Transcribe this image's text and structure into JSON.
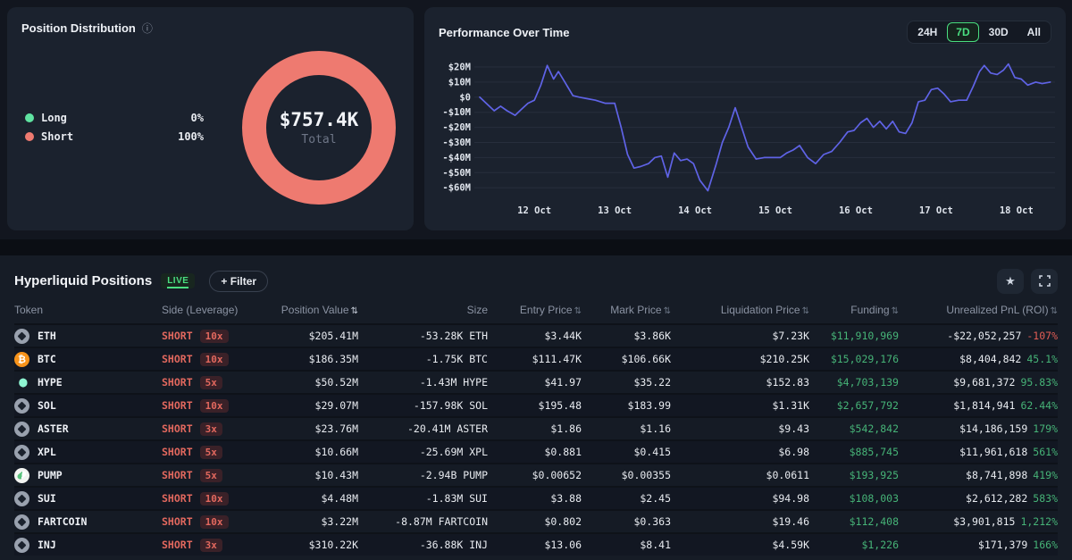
{
  "position_distribution": {
    "title": "Position Distribution",
    "info_icon": "ⓘ",
    "legend": [
      {
        "label": "Long",
        "pct": "0%",
        "color": "#5fe3a1"
      },
      {
        "label": "Short",
        "pct": "100%",
        "color": "#ee7a70"
      }
    ],
    "total_value": "$757.4K",
    "total_label": "Total",
    "donut_color": "#ee7a70"
  },
  "performance": {
    "title": "Performance Over Time",
    "ranges": [
      {
        "label": "24H",
        "active": false
      },
      {
        "label": "7D",
        "active": true
      },
      {
        "label": "30D",
        "active": false
      },
      {
        "label": "All",
        "active": false
      }
    ]
  },
  "chart_data": [
    {
      "type": "pie",
      "title": "Position Distribution",
      "labels": [
        "Long",
        "Short"
      ],
      "values": [
        0,
        100
      ],
      "colors": [
        "#5fe3a1",
        "#ee7a70"
      ],
      "center_total": "$757.4K"
    },
    {
      "type": "line",
      "title": "Performance Over Time",
      "unit": "$M",
      "line_color": "#5f63e6",
      "grid": true,
      "xlim": [
        11.32,
        18.48
      ],
      "ylim": [
        -66,
        25
      ],
      "y_ticks": [
        {
          "value": 20,
          "label": "$20M"
        },
        {
          "value": 10,
          "label": "$10M"
        },
        {
          "value": 0,
          "label": "$0"
        },
        {
          "value": -10,
          "label": "-$10M"
        },
        {
          "value": -20,
          "label": "-$20M"
        },
        {
          "value": -30,
          "label": "-$30M"
        },
        {
          "value": -40,
          "label": "-$40M"
        },
        {
          "value": -50,
          "label": "-$50M"
        },
        {
          "value": -60,
          "label": "-$60M"
        }
      ],
      "x_ticks": [
        {
          "value": 12,
          "label": "12 Oct"
        },
        {
          "value": 13,
          "label": "13 Oct"
        },
        {
          "value": 14,
          "label": "14 Oct"
        },
        {
          "value": 15,
          "label": "15 Oct"
        },
        {
          "value": 16,
          "label": "16 Oct"
        },
        {
          "value": 17,
          "label": "17 Oct"
        },
        {
          "value": 18,
          "label": "18 Oct"
        }
      ],
      "points": [
        [
          11.32,
          0
        ],
        [
          11.42,
          -5
        ],
        [
          11.5,
          -9
        ],
        [
          11.58,
          -6
        ],
        [
          11.66,
          -9
        ],
        [
          11.76,
          -12
        ],
        [
          11.84,
          -8
        ],
        [
          11.92,
          -4
        ],
        [
          12.0,
          -2
        ],
        [
          12.08,
          8
        ],
        [
          12.16,
          21
        ],
        [
          12.24,
          12
        ],
        [
          12.3,
          17
        ],
        [
          12.38,
          10
        ],
        [
          12.48,
          1
        ],
        [
          12.56,
          0
        ],
        [
          12.66,
          -1
        ],
        [
          12.76,
          -2
        ],
        [
          12.88,
          -4
        ],
        [
          13.0,
          -4
        ],
        [
          13.08,
          -20
        ],
        [
          13.16,
          -38
        ],
        [
          13.24,
          -47
        ],
        [
          13.32,
          -46
        ],
        [
          13.42,
          -44
        ],
        [
          13.5,
          -40
        ],
        [
          13.58,
          -39
        ],
        [
          13.66,
          -53
        ],
        [
          13.74,
          -37
        ],
        [
          13.82,
          -42
        ],
        [
          13.9,
          -41
        ],
        [
          13.98,
          -44
        ],
        [
          14.06,
          -55
        ],
        [
          14.16,
          -62
        ],
        [
          14.26,
          -45
        ],
        [
          14.34,
          -30
        ],
        [
          14.42,
          -20
        ],
        [
          14.5,
          -7
        ],
        [
          14.58,
          -20
        ],
        [
          14.66,
          -33
        ],
        [
          14.76,
          -41
        ],
        [
          14.86,
          -40
        ],
        [
          14.96,
          -40
        ],
        [
          15.06,
          -40
        ],
        [
          15.14,
          -37
        ],
        [
          15.22,
          -35
        ],
        [
          15.3,
          -32
        ],
        [
          15.4,
          -40
        ],
        [
          15.5,
          -44
        ],
        [
          15.6,
          -38
        ],
        [
          15.7,
          -36
        ],
        [
          15.8,
          -30
        ],
        [
          15.9,
          -23
        ],
        [
          15.98,
          -22
        ],
        [
          16.06,
          -17
        ],
        [
          16.14,
          -14
        ],
        [
          16.22,
          -20
        ],
        [
          16.3,
          -16
        ],
        [
          16.38,
          -21
        ],
        [
          16.46,
          -16
        ],
        [
          16.54,
          -23
        ],
        [
          16.62,
          -24
        ],
        [
          16.7,
          -17
        ],
        [
          16.78,
          -3
        ],
        [
          16.86,
          -2
        ],
        [
          16.94,
          5
        ],
        [
          17.02,
          6
        ],
        [
          17.1,
          2
        ],
        [
          17.18,
          -3
        ],
        [
          17.28,
          -2
        ],
        [
          17.38,
          -2
        ],
        [
          17.46,
          7
        ],
        [
          17.54,
          17
        ],
        [
          17.6,
          21
        ],
        [
          17.68,
          16
        ],
        [
          17.76,
          15
        ],
        [
          17.84,
          18
        ],
        [
          17.9,
          22
        ],
        [
          17.98,
          13
        ],
        [
          18.06,
          12
        ],
        [
          18.14,
          8
        ],
        [
          18.24,
          10
        ],
        [
          18.32,
          9
        ],
        [
          18.42,
          10
        ]
      ]
    }
  ],
  "positions": {
    "title": "Hyperliquid Positions",
    "live_label": "LIVE",
    "filter_label": "+ Filter",
    "star_icon": "★",
    "sort_icon": "⇅",
    "colors": {
      "pos": "#46b377",
      "neg": "#e25d55"
    },
    "columns": [
      {
        "label": "Token",
        "align": "left",
        "sort": null
      },
      {
        "label": "Side (Leverage)",
        "align": "left",
        "sort": null
      },
      {
        "label": "Position Value",
        "align": "right",
        "sort": "active"
      },
      {
        "label": "Size",
        "align": "right",
        "sort": null
      },
      {
        "label": "Entry Price",
        "align": "right",
        "sort": "inactive"
      },
      {
        "label": "Mark Price",
        "align": "right",
        "sort": "inactive"
      },
      {
        "label": "Liquidation Price",
        "align": "right",
        "sort": "inactive"
      },
      {
        "label": "Funding",
        "align": "right",
        "sort": "inactive"
      },
      {
        "label": "Unrealized PnL (ROI)",
        "align": "right",
        "sort": "inactive"
      }
    ],
    "rows": [
      {
        "token": "ETH",
        "icon": "generic",
        "side": "SHORT",
        "leverage": "10x",
        "position_value": "$205.41M",
        "size": "-53.28K ETH",
        "entry": "$3.44K",
        "mark": "$3.86K",
        "liq": "$7.23K",
        "funding": "$11,910,969",
        "pnl": "-$22,052,257",
        "roi": "-107%",
        "roi_positive": false
      },
      {
        "token": "BTC",
        "icon": "btc",
        "side": "SHORT",
        "leverage": "10x",
        "position_value": "$186.35M",
        "size": "-1.75K BTC",
        "entry": "$111.47K",
        "mark": "$106.66K",
        "liq": "$210.25K",
        "funding": "$15,029,176",
        "pnl": "$8,404,842",
        "roi": "45.1%",
        "roi_positive": true
      },
      {
        "token": "HYPE",
        "icon": "hype",
        "side": "SHORT",
        "leverage": "5x",
        "position_value": "$50.52M",
        "size": "-1.43M HYPE",
        "entry": "$41.97",
        "mark": "$35.22",
        "liq": "$152.83",
        "funding": "$4,703,139",
        "pnl": "$9,681,372",
        "roi": "95.83%",
        "roi_positive": true
      },
      {
        "token": "SOL",
        "icon": "generic",
        "side": "SHORT",
        "leverage": "10x",
        "position_value": "$29.07M",
        "size": "-157.98K SOL",
        "entry": "$195.48",
        "mark": "$183.99",
        "liq": "$1.31K",
        "funding": "$2,657,792",
        "pnl": "$1,814,941",
        "roi": "62.44%",
        "roi_positive": true
      },
      {
        "token": "ASTER",
        "icon": "generic",
        "side": "SHORT",
        "leverage": "3x",
        "position_value": "$23.76M",
        "size": "-20.41M ASTER",
        "entry": "$1.86",
        "mark": "$1.16",
        "liq": "$9.43",
        "funding": "$542,842",
        "pnl": "$14,186,159",
        "roi": "179%",
        "roi_positive": true
      },
      {
        "token": "XPL",
        "icon": "generic",
        "side": "SHORT",
        "leverage": "5x",
        "position_value": "$10.66M",
        "size": "-25.69M XPL",
        "entry": "$0.881",
        "mark": "$0.415",
        "liq": "$6.98",
        "funding": "$885,745",
        "pnl": "$11,961,618",
        "roi": "561%",
        "roi_positive": true
      },
      {
        "token": "PUMP",
        "icon": "pump",
        "side": "SHORT",
        "leverage": "5x",
        "position_value": "$10.43M",
        "size": "-2.94B PUMP",
        "entry": "$0.00652",
        "mark": "$0.00355",
        "liq": "$0.0611",
        "funding": "$193,925",
        "pnl": "$8,741,898",
        "roi": "419%",
        "roi_positive": true
      },
      {
        "token": "SUI",
        "icon": "generic",
        "side": "SHORT",
        "leverage": "10x",
        "position_value": "$4.48M",
        "size": "-1.83M SUI",
        "entry": "$3.88",
        "mark": "$2.45",
        "liq": "$94.98",
        "funding": "$108,003",
        "pnl": "$2,612,282",
        "roi": "583%",
        "roi_positive": true
      },
      {
        "token": "FARTCOIN",
        "icon": "generic",
        "side": "SHORT",
        "leverage": "10x",
        "position_value": "$3.22M",
        "size": "-8.87M FARTCOIN",
        "entry": "$0.802",
        "mark": "$0.363",
        "liq": "$19.46",
        "funding": "$112,408",
        "pnl": "$3,901,815",
        "roi": "1,212%",
        "roi_positive": true
      },
      {
        "token": "INJ",
        "icon": "generic",
        "side": "SHORT",
        "leverage": "3x",
        "position_value": "$310.22K",
        "size": "-36.88K INJ",
        "entry": "$13.06",
        "mark": "$8.41",
        "liq": "$4.59K",
        "funding": "$1,226",
        "pnl": "$171,379",
        "roi": "166%",
        "roi_positive": true
      }
    ]
  }
}
